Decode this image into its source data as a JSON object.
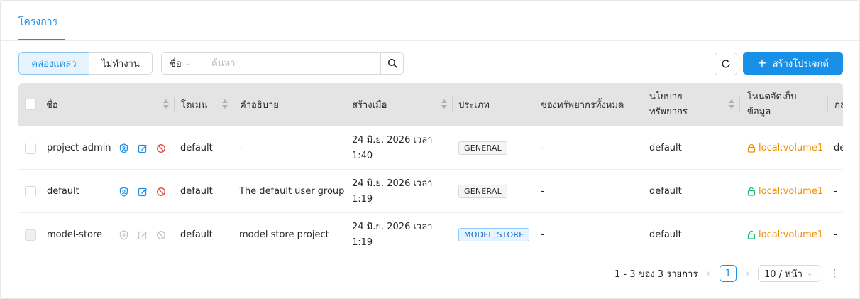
{
  "tabs": [
    {
      "label": "โครงการ",
      "active": true
    }
  ],
  "filter_toggle": {
    "active_label": "คล่องแคล่ว",
    "inactive_label": "ไม่ทำงาน"
  },
  "search": {
    "field_label": "ชื่อ",
    "placeholder": "ค้นหา"
  },
  "actions": {
    "create_label": "สร้างโปรเจกต์"
  },
  "table": {
    "columns": [
      "ชื่อ",
      "โดเมน",
      "คำอธิบาย",
      "สร้างเมื่อ",
      "ประเภท",
      "ช่องทรัพยากรทั้งหมด",
      "นโยบายทรัพยากร",
      "โหนดจัดเก็บข้อมูล",
      "กล"
    ],
    "rows": [
      {
        "name": "project-admin",
        "domain": "default",
        "description": "-",
        "created_at": "24 มิ.ย. 2026 เวลา 1:40",
        "type": "GENERAL",
        "total_resource_slots": "-",
        "resource_policy": "default",
        "storage_host": "local:volume1",
        "extra": "de",
        "actions_disabled": false
      },
      {
        "name": "default",
        "domain": "default",
        "description": "The default user group",
        "created_at": "24 มิ.ย. 2026 เวลา 1:19",
        "type": "GENERAL",
        "total_resource_slots": "-",
        "resource_policy": "default",
        "storage_host": "local:volume1",
        "extra": "-",
        "actions_disabled": false
      },
      {
        "name": "model-store",
        "domain": "default",
        "description": "model store project",
        "created_at": "24 มิ.ย. 2026 เวลา 1:19",
        "type": "MODEL_STORE",
        "total_resource_slots": "-",
        "resource_policy": "default",
        "storage_host": "local:volume1",
        "extra": "-",
        "actions_disabled": true
      }
    ]
  },
  "pagination": {
    "total_text": "1 - 3 ของ 3 รายการ",
    "current_page": "1",
    "page_size_label": "10 / หน้า"
  },
  "colors": {
    "primary": "#1890e8",
    "storage_locked": "#f08c00",
    "storage_unlocked": "#22b573",
    "danger": "#e5484d"
  },
  "icons": {
    "search": "search-icon",
    "refresh": "refresh-icon",
    "create": "plus-icon",
    "row_actions": [
      "shield-icon",
      "edit-icon",
      "ban-icon"
    ],
    "storage": [
      "lock-icon",
      "unlock-icon"
    ]
  }
}
